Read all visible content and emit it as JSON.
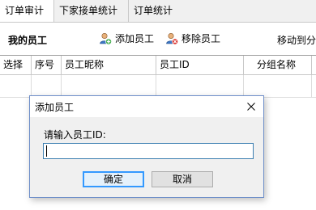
{
  "tabs": [
    {
      "label": "订单审计"
    },
    {
      "label": "下家接单统计"
    },
    {
      "label": "订单统计"
    }
  ],
  "toolbar": {
    "section_title": "我的员工",
    "add_label": "添加员工",
    "remove_label": "移除员工",
    "move_label": "移动到分"
  },
  "grid": {
    "columns": [
      "选择",
      "序号",
      "员工昵称",
      "员工ID",
      "分组名称"
    ]
  },
  "dialog": {
    "title": "添加员工",
    "prompt": "请输入员工ID:",
    "input_value": "",
    "ok_label": "确定",
    "cancel_label": "取消"
  },
  "colors": {
    "dialog_border": "#6f8fc9",
    "input_border": "#3c7fb1",
    "default_button_border": "#3399ff",
    "tab_bar_bg": "#f0f0f0"
  },
  "icons": {
    "add": "add-user-icon",
    "remove": "remove-user-icon",
    "close": "close-icon"
  }
}
